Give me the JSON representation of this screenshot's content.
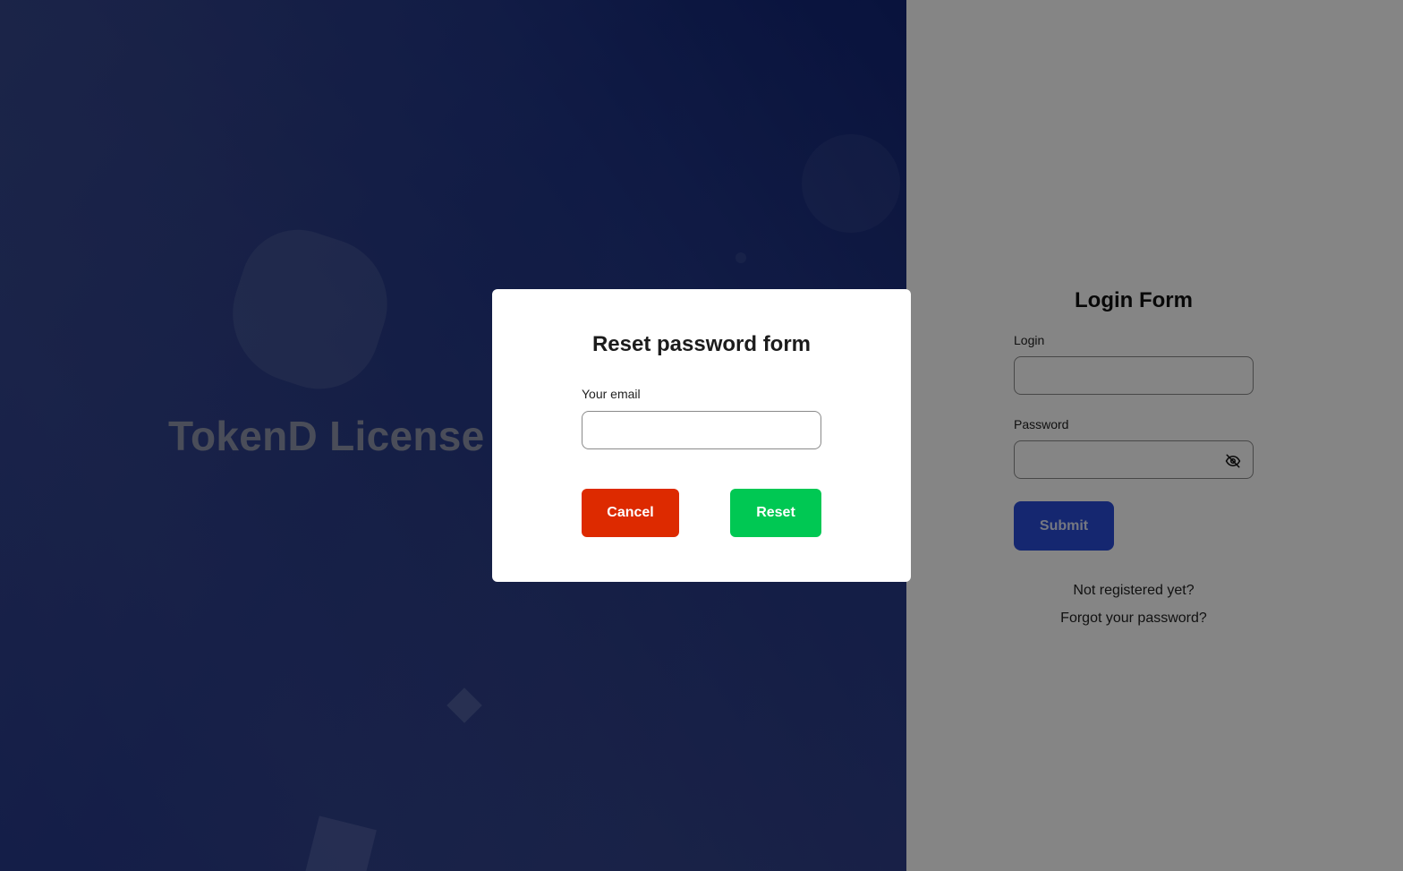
{
  "hero": {
    "title": "TokenD License M",
    "gradient_colors": [
      "#0b1f72",
      "#273a86",
      "#243789"
    ]
  },
  "login": {
    "title": "Login Form",
    "login_label": "Login",
    "login_value": "",
    "password_label": "Password",
    "password_value": "",
    "password_toggle_icon": "eye-off-icon",
    "submit_label": "Submit",
    "register_link": "Not registered yet?",
    "forgot_link": "Forgot your password?",
    "accent_color": "#2a4bd7"
  },
  "modal": {
    "title": "Reset password form",
    "email_label": "Your email",
    "email_value": "",
    "cancel_label": "Cancel",
    "reset_label": "Reset",
    "cancel_color": "#dd2a00",
    "reset_color": "#00c853"
  }
}
